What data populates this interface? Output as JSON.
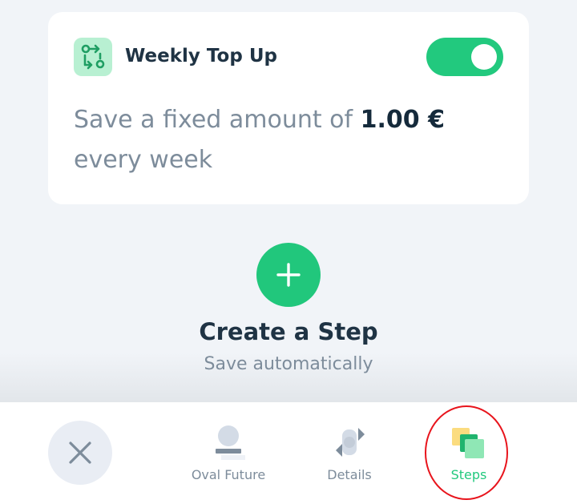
{
  "card": {
    "title": "Weekly Top Up",
    "icon": "repeat-transfer-icon",
    "toggle_on": true,
    "text_prefix": "Save a fixed amount of ",
    "amount": "1.00 €",
    "text_suffix": "every week"
  },
  "create": {
    "icon": "plus-icon",
    "title": "Create a Step",
    "subtitle": "Save automatically"
  },
  "nav": {
    "close_icon": "close-icon",
    "items": [
      {
        "label": "Oval Future",
        "icon": "oval-future-icon",
        "active": false
      },
      {
        "label": "Details",
        "icon": "details-icon",
        "active": false
      },
      {
        "label": "Steps",
        "icon": "steps-icon",
        "active": true
      }
    ]
  },
  "colors": {
    "accent": "#22c97e",
    "text_dark": "#1f3344",
    "text_muted": "#7d8c9b",
    "background": "#f1f4f8",
    "annotation": "#e8141c"
  }
}
